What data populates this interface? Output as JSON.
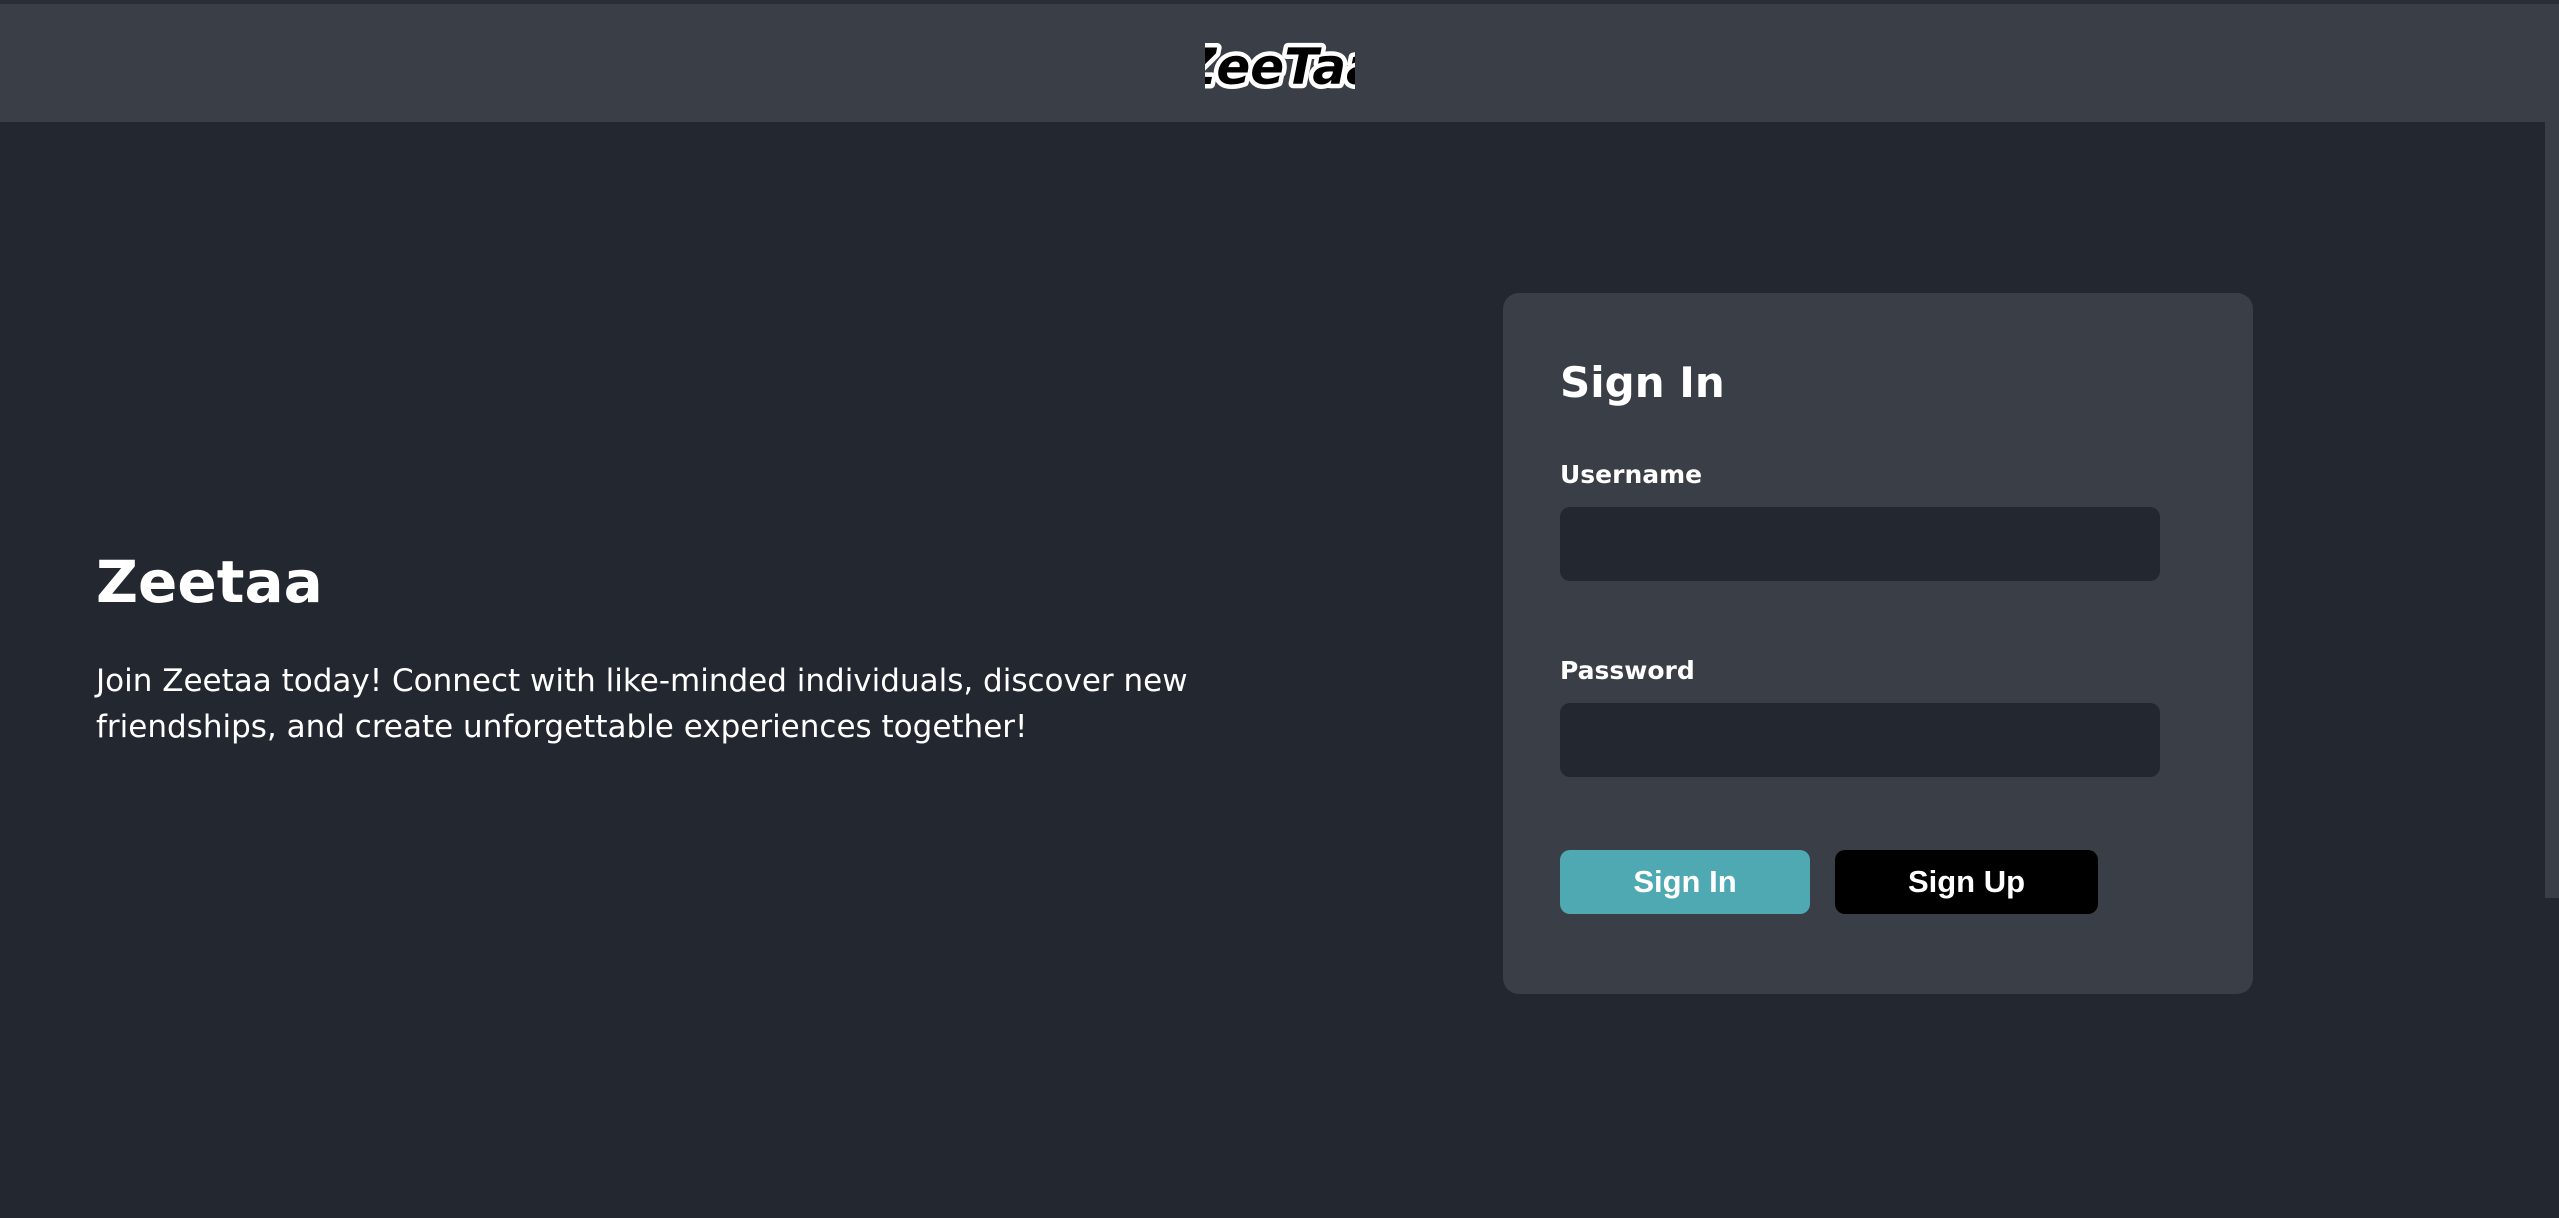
{
  "header": {
    "logo_text": "ZeeTaa"
  },
  "hero": {
    "title": "Zeetaa",
    "description": "Join Zeetaa today! Connect with like-minded individuals, discover new friendships, and create unforgettable experiences together!"
  },
  "signin_form": {
    "title": "Sign In",
    "username_label": "Username",
    "username_value": "",
    "password_label": "Password",
    "password_value": "",
    "signin_button": "Sign In",
    "signup_button": "Sign Up"
  },
  "colors": {
    "background": "#23272f",
    "header": "#3a3e46",
    "card": "#3a3e46",
    "input": "#23272f",
    "accent": "#4fa9b3",
    "signup_button": "#000000",
    "text": "#ffffff"
  }
}
